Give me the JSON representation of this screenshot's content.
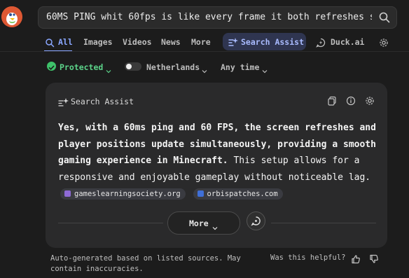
{
  "search": {
    "query": "60MS PING whit 60fps is like every frame it both refreshes s"
  },
  "tabs": [
    {
      "label": "All",
      "active": true
    },
    {
      "label": "Images"
    },
    {
      "label": "Videos"
    },
    {
      "label": "News"
    },
    {
      "label": "More"
    },
    {
      "label": "Search Assist"
    },
    {
      "label": "Duck.ai"
    }
  ],
  "filters": {
    "protected": "Protected",
    "region": "Netherlands",
    "time": "Any time"
  },
  "assist": {
    "title": "Search Assist",
    "answer_bold": "Yes, with a 60ms ping and 60 FPS, the screen refreshes and player positions update simultaneously, providing a smooth gaming experience in Minecraft.",
    "answer_rest": " This setup allows for a responsive and enjoyable gameplay without noticeable lag.",
    "sources": [
      {
        "label": "gameslearningsociety.org",
        "color": "#8e6ad6"
      },
      {
        "label": "orbispatches.com",
        "color": "#3f6fd8"
      }
    ],
    "more_label": "More"
  },
  "footer": {
    "disclaimer": "Auto-generated based on listed sources. May contain inaccuracies.",
    "helpful": "Was this helpful?"
  },
  "colors": {
    "background": "#1c1c1c",
    "card": "#2a2a2b",
    "accent": "#8aa7ff",
    "brand": "#de5833",
    "protected": "#3ec26a"
  }
}
